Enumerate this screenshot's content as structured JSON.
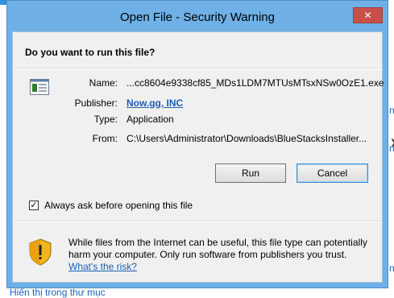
{
  "background": {
    "left_link": "Hiển thị trong thư mục",
    "right_fragments": [
      "n",
      "n",
      "n"
    ],
    "chevron": "❯"
  },
  "dialog": {
    "title": "Open File - Security Warning",
    "close_glyph": "✕",
    "question": "Do you want to run this file?",
    "fields": {
      "name_label": "Name:",
      "name_value": "...cc8604e9338cf85_MDs1LDM7MTUsMTsxNSw0OzE1.exe",
      "publisher_label": "Publisher:",
      "publisher_value": "Now.gg, INC",
      "type_label": "Type:",
      "type_value": "Application",
      "from_label": "From:",
      "from_value": "C:\\Users\\Administrator\\Downloads\\BlueStacksInstaller..."
    },
    "buttons": {
      "run": "Run",
      "cancel": "Cancel"
    },
    "always_ask": {
      "label": "Always ask before opening this file",
      "checked": true,
      "check_glyph": "✓"
    },
    "warning": {
      "text": "While files from the Internet can be useful, this file type can potentially harm your computer. Only run software from publishers you trust.",
      "link": "What's the risk?"
    },
    "icons": {
      "file": "application-file-icon",
      "shield": "security-shield-icon"
    },
    "colors": {
      "frame": "#6fb1e6",
      "close": "#c9504a",
      "link": "#1a5fb4",
      "client": "#f0f0f0"
    }
  }
}
